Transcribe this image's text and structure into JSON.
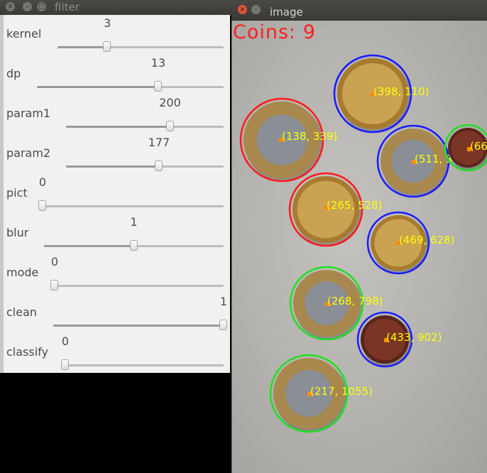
{
  "filter_window": {
    "title": "filter",
    "trackbars": [
      {
        "label": "kernel",
        "value": "3",
        "fraction": 0.3
      },
      {
        "label": "dp",
        "value": "13",
        "fraction": 0.65
      },
      {
        "label": "param1",
        "value": "200",
        "fraction": 0.66
      },
      {
        "label": "param2",
        "value": "177",
        "fraction": 0.59
      },
      {
        "label": "pict",
        "value": "0",
        "fraction": 0.0
      },
      {
        "label": "blur",
        "value": "1",
        "fraction": 0.5
      },
      {
        "label": "mode",
        "value": "0",
        "fraction": 0.0
      },
      {
        "label": "clean",
        "value": "1",
        "fraction": 1.0
      },
      {
        "label": "classify",
        "value": "0",
        "fraction": 0.0
      }
    ]
  },
  "image_window": {
    "title": "image",
    "coin_count_label": "Coins: 9",
    "coins": [
      {
        "label": "(398, 110)",
        "circle_color": "#1a1aff",
        "coin_type": "gold"
      },
      {
        "label": "(138, 339)",
        "circle_color": "#ff1a1a",
        "coin_type": "bimetal"
      },
      {
        "label": "(511, 399)",
        "circle_color": "#1a1aff",
        "coin_type": "bimetal"
      },
      {
        "label": "(66",
        "circle_color": "#20e020",
        "coin_type": "copper"
      },
      {
        "label": "(265, 528)",
        "circle_color": "#ff1a1a",
        "coin_type": "gold"
      },
      {
        "label": "(469, 628)",
        "circle_color": "#1a1aff",
        "coin_type": "gold"
      },
      {
        "label": "(268, 798)",
        "circle_color": "#20e020",
        "coin_type": "bimetal"
      },
      {
        "label": "(433, 902)",
        "circle_color": "#1a1aff",
        "coin_type": "copper"
      },
      {
        "label": "(217, 1055)",
        "circle_color": "#20e020",
        "coin_type": "bimetal"
      }
    ],
    "label_color": "#ffff00",
    "center_marker_color": "#ff8c00"
  }
}
